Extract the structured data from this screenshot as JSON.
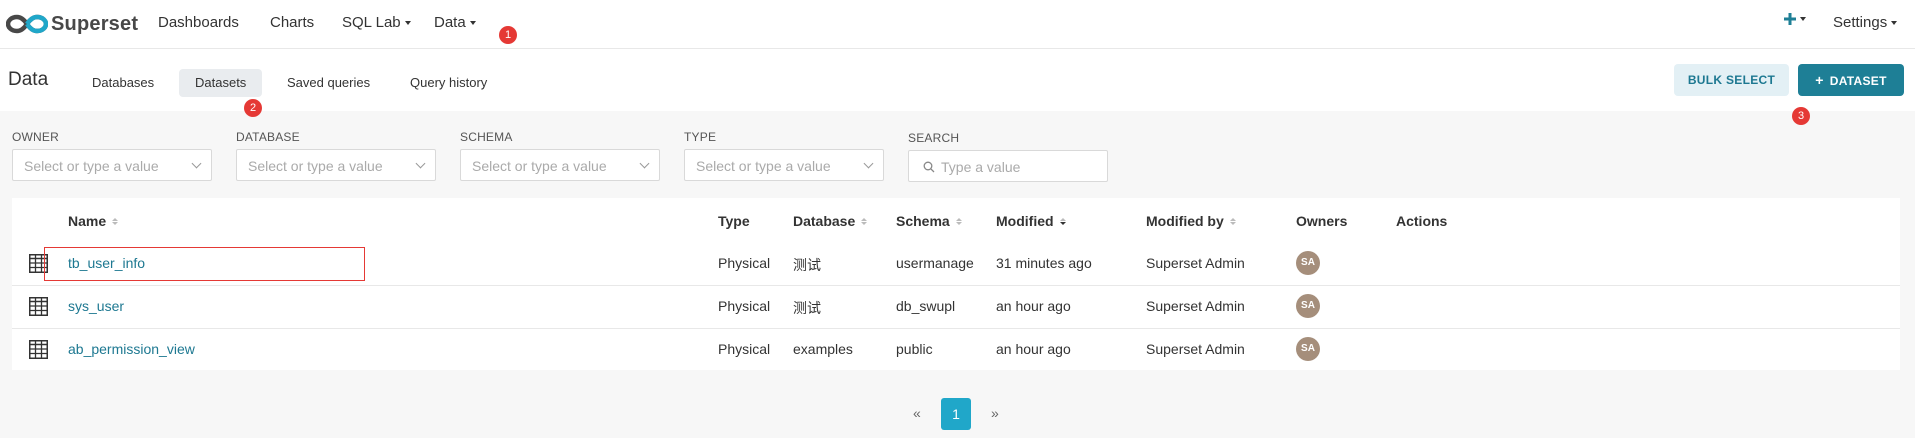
{
  "navbar": {
    "brand": "Superset",
    "menu": [
      {
        "label": "Dashboards"
      },
      {
        "label": "Charts"
      },
      {
        "label": "SQL Lab"
      },
      {
        "label": "Data"
      }
    ],
    "plus_icon": "plus-icon",
    "settings_label": "Settings",
    "callout_1": "1"
  },
  "subheader": {
    "title": "Data",
    "tabs": [
      {
        "label": "Databases"
      },
      {
        "label": "Datasets"
      },
      {
        "label": "Saved queries"
      },
      {
        "label": "Query history"
      }
    ],
    "active_tab": "Datasets",
    "callout_2": "2",
    "bulk_select_label": "BULK SELECT",
    "add_dataset_label": "DATASET",
    "callout_3": "3"
  },
  "filters": {
    "owner_label": "OWNER",
    "owner_placeholder": "Select or type a value",
    "database_label": "DATABASE",
    "database_placeholder": "Select or type a value",
    "schema_label": "SCHEMA",
    "schema_placeholder": "Select or type a value",
    "type_label": "TYPE",
    "type_placeholder": "Select or type a value",
    "search_label": "SEARCH",
    "search_placeholder": "Type a value"
  },
  "table": {
    "headers": {
      "name": "Name",
      "type": "Type",
      "database": "Database",
      "schema": "Schema",
      "modified": "Modified",
      "modified_by": "Modified by",
      "owners": "Owners",
      "actions": "Actions"
    },
    "rows": [
      {
        "name": "tb_user_info",
        "type": "Physical",
        "database": "测试",
        "schema": "usermanage",
        "modified": "31 minutes ago",
        "modified_by": "Superset Admin",
        "owner_initials": "SA"
      },
      {
        "name": "sys_user",
        "type": "Physical",
        "database": "测试",
        "schema": "db_swupl",
        "modified": "an hour ago",
        "modified_by": "Superset Admin",
        "owner_initials": "SA"
      },
      {
        "name": "ab_permission_view",
        "type": "Physical",
        "database": "examples",
        "schema": "public",
        "modified": "an hour ago",
        "modified_by": "Superset Admin",
        "owner_initials": "SA"
      }
    ]
  },
  "pagination": {
    "prev": "«",
    "current": "1",
    "next": "»"
  },
  "colors": {
    "accent": "#1e7f96",
    "link": "#1d7891",
    "callout": "#e53935",
    "page_active": "#20a7c9",
    "avatar": "#a58e7b"
  }
}
